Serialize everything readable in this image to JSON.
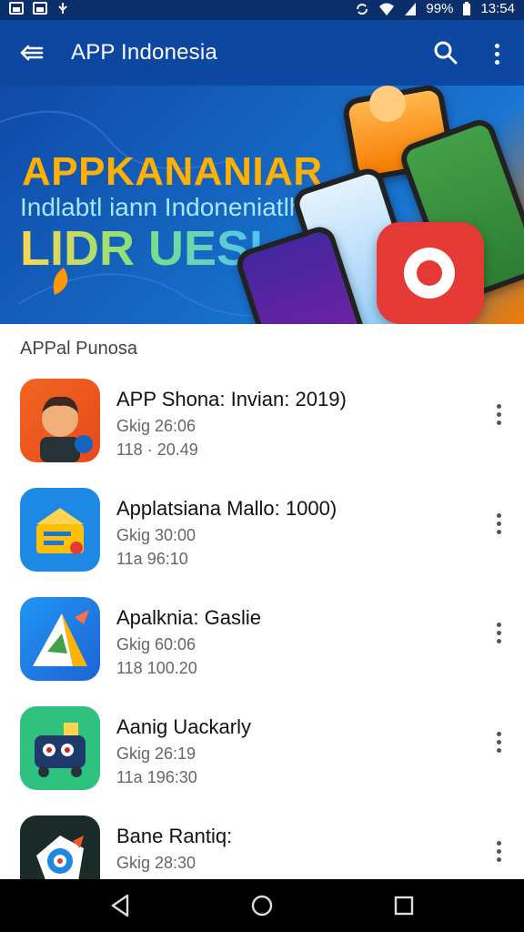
{
  "status_bar": {
    "battery": "99%",
    "time": "13:54"
  },
  "app_bar": {
    "title": "APP Indonesia"
  },
  "banner": {
    "headline": "APPKANANIAR",
    "subheadline": "Indlabtl iann Indoneniatlh",
    "tagline": "LIDR UESI"
  },
  "section": {
    "title": "APPal Punosa"
  },
  "apps": [
    {
      "name": "APP Shona: Invian: 2019)",
      "meta1": "Gkig 26:06",
      "meta2": "118 · 20.49",
      "icon": "person-avatar-icon",
      "color": "#f26522"
    },
    {
      "name": "Applatsiana Mallo: 1000)",
      "meta1": "Gkig 30:00",
      "meta2": "11a 96:10",
      "icon": "folder-house-icon",
      "color": "#1e88e5"
    },
    {
      "name": "Apalknia: Gaslie",
      "meta1": "Gkig 60:06",
      "meta2": "118 100.20",
      "icon": "triangle-arrow-icon",
      "color": "#1e63d6"
    },
    {
      "name": "Aanig Uackarly",
      "meta1": "Gkig 26:19",
      "meta2": "11a 196:30",
      "icon": "robot-car-icon",
      "color": "#2ec27e"
    },
    {
      "name": "Bane Rantiq:",
      "meta1": "Gkig 28:30",
      "meta2": "",
      "icon": "target-badge-icon",
      "color": "#1b2b2a"
    }
  ]
}
